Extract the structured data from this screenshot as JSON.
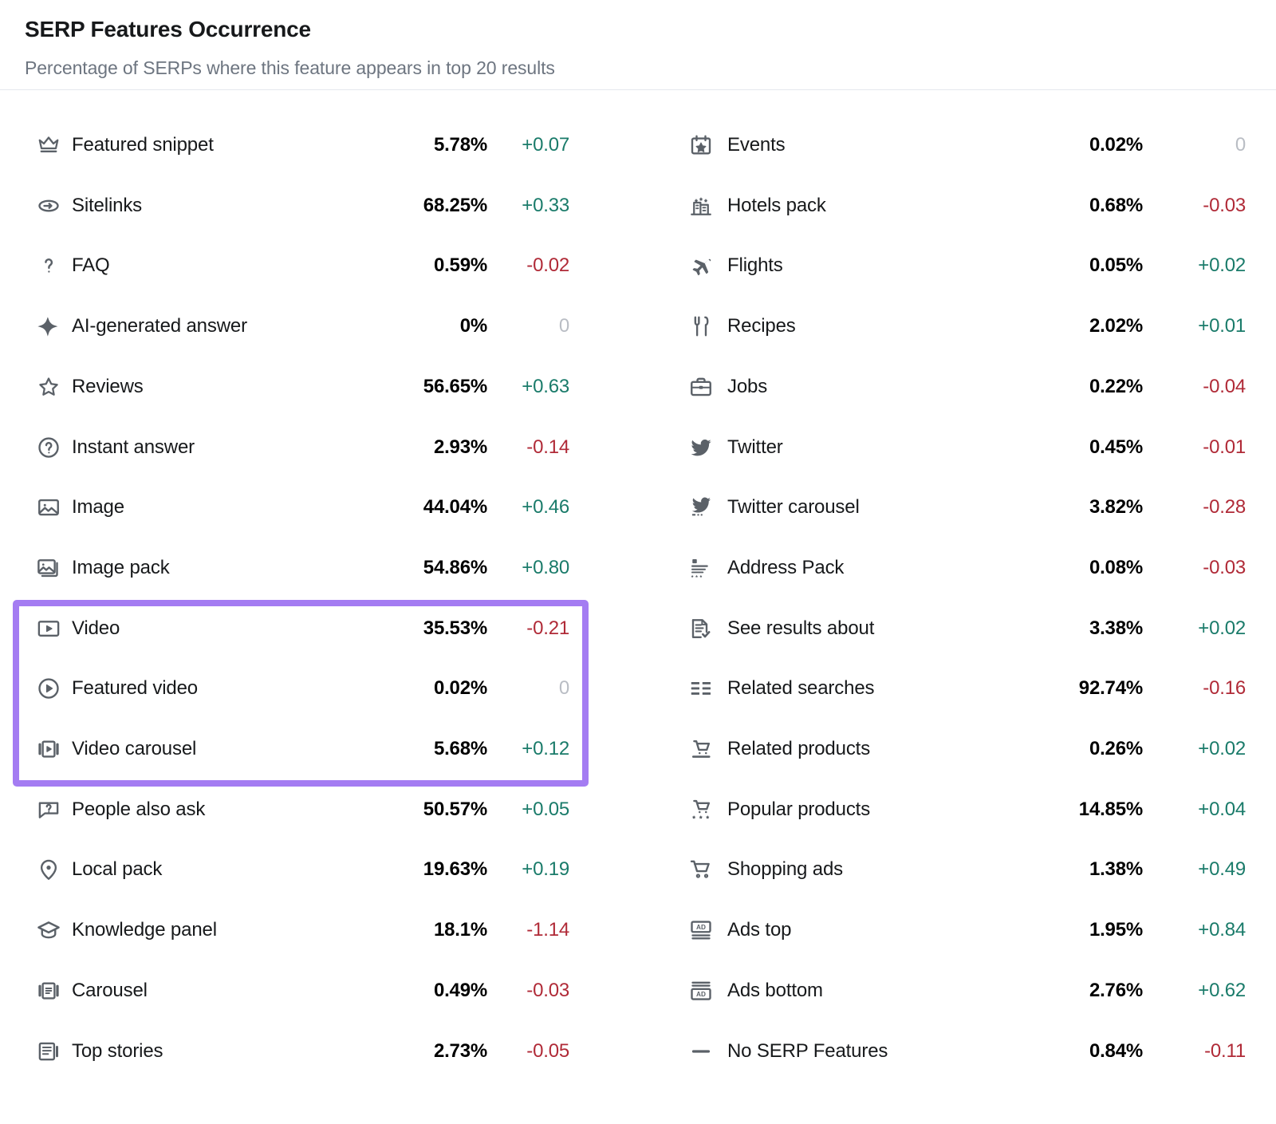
{
  "header": {
    "title": "SERP Features Occurrence",
    "subtitle": "Percentage of SERPs where this feature appears in top 20 results"
  },
  "highlight": {
    "color": "#a47cf2",
    "rows": [
      "Video",
      "Featured video",
      "Video carousel"
    ]
  },
  "colors": {
    "positive": "#1a7b6a",
    "negative": "#b02a37",
    "neutral": "#b9bdc4",
    "value": "#000000",
    "label": "#17191b",
    "icon": "#5b6168",
    "accent": "#a47cf2"
  },
  "left_column": [
    {
      "icon": "crown-icon",
      "label": "Featured snippet",
      "value": "5.78%",
      "delta": "+0.07",
      "trend": "up"
    },
    {
      "icon": "sitelinks-icon",
      "label": "Sitelinks",
      "value": "68.25%",
      "delta": "+0.33",
      "trend": "up"
    },
    {
      "icon": "question-mark-icon",
      "label": "FAQ",
      "value": "0.59%",
      "delta": "-0.02",
      "trend": "down"
    },
    {
      "icon": "ai-sparkle-icon",
      "label": "AI-generated answer",
      "value": "0%",
      "delta": "0",
      "trend": "flat"
    },
    {
      "icon": "star-icon",
      "label": "Reviews",
      "value": "56.65%",
      "delta": "+0.63",
      "trend": "up"
    },
    {
      "icon": "question-circle-icon",
      "label": "Instant answer",
      "value": "2.93%",
      "delta": "-0.14",
      "trend": "down"
    },
    {
      "icon": "image-icon",
      "label": "Image",
      "value": "44.04%",
      "delta": "+0.46",
      "trend": "up"
    },
    {
      "icon": "image-pack-icon",
      "label": "Image pack",
      "value": "54.86%",
      "delta": "+0.80",
      "trend": "up"
    },
    {
      "icon": "video-icon",
      "label": "Video",
      "value": "35.53%",
      "delta": "-0.21",
      "trend": "down"
    },
    {
      "icon": "play-circle-icon",
      "label": "Featured video",
      "value": "0.02%",
      "delta": "0",
      "trend": "flat"
    },
    {
      "icon": "video-carousel-icon",
      "label": "Video carousel",
      "value": "5.68%",
      "delta": "+0.12",
      "trend": "up"
    },
    {
      "icon": "speech-question-icon",
      "label": "People also ask",
      "value": "50.57%",
      "delta": "+0.05",
      "trend": "up"
    },
    {
      "icon": "map-pin-icon",
      "label": "Local pack",
      "value": "19.63%",
      "delta": "+0.19",
      "trend": "up"
    },
    {
      "icon": "graduation-cap-icon",
      "label": "Knowledge panel",
      "value": "18.1%",
      "delta": "-1.14",
      "trend": "down"
    },
    {
      "icon": "carousel-icon",
      "label": "Carousel",
      "value": "0.49%",
      "delta": "-0.03",
      "trend": "down"
    },
    {
      "icon": "top-stories-icon",
      "label": "Top stories",
      "value": "2.73%",
      "delta": "-0.05",
      "trend": "down"
    }
  ],
  "right_column": [
    {
      "icon": "calendar-star-icon",
      "label": "Events",
      "value": "0.02%",
      "delta": "0",
      "trend": "flat"
    },
    {
      "icon": "hotel-icon",
      "label": "Hotels pack",
      "value": "0.68%",
      "delta": "-0.03",
      "trend": "down"
    },
    {
      "icon": "airplane-icon",
      "label": "Flights",
      "value": "0.05%",
      "delta": "+0.02",
      "trend": "up"
    },
    {
      "icon": "fork-knife-icon",
      "label": "Recipes",
      "value": "2.02%",
      "delta": "+0.01",
      "trend": "up"
    },
    {
      "icon": "briefcase-icon",
      "label": "Jobs",
      "value": "0.22%",
      "delta": "-0.04",
      "trend": "down"
    },
    {
      "icon": "twitter-bird-icon",
      "label": "Twitter",
      "value": "0.45%",
      "delta": "-0.01",
      "trend": "down"
    },
    {
      "icon": "twitter-carousel-icon",
      "label": "Twitter carousel",
      "value": "3.82%",
      "delta": "-0.28",
      "trend": "down"
    },
    {
      "icon": "address-pack-icon",
      "label": "Address Pack",
      "value": "0.08%",
      "delta": "-0.03",
      "trend": "down"
    },
    {
      "icon": "document-check-icon",
      "label": "See results about",
      "value": "3.38%",
      "delta": "+0.02",
      "trend": "up"
    },
    {
      "icon": "related-searches-icon",
      "label": "Related searches",
      "value": "92.74%",
      "delta": "-0.16",
      "trend": "down"
    },
    {
      "icon": "cart-line-icon",
      "label": "Related products",
      "value": "0.26%",
      "delta": "+0.02",
      "trend": "up"
    },
    {
      "icon": "cart-stars-icon",
      "label": "Popular products",
      "value": "14.85%",
      "delta": "+0.04",
      "trend": "up"
    },
    {
      "icon": "shopping-cart-icon",
      "label": "Shopping ads",
      "value": "1.38%",
      "delta": "+0.49",
      "trend": "up"
    },
    {
      "icon": "ads-top-icon",
      "label": "Ads top",
      "value": "1.95%",
      "delta": "+0.84",
      "trend": "up"
    },
    {
      "icon": "ads-bottom-icon",
      "label": "Ads bottom",
      "value": "2.76%",
      "delta": "+0.62",
      "trend": "up"
    },
    {
      "icon": "dash-icon",
      "label": "No SERP Features",
      "value": "0.84%",
      "delta": "-0.11",
      "trend": "down"
    }
  ]
}
